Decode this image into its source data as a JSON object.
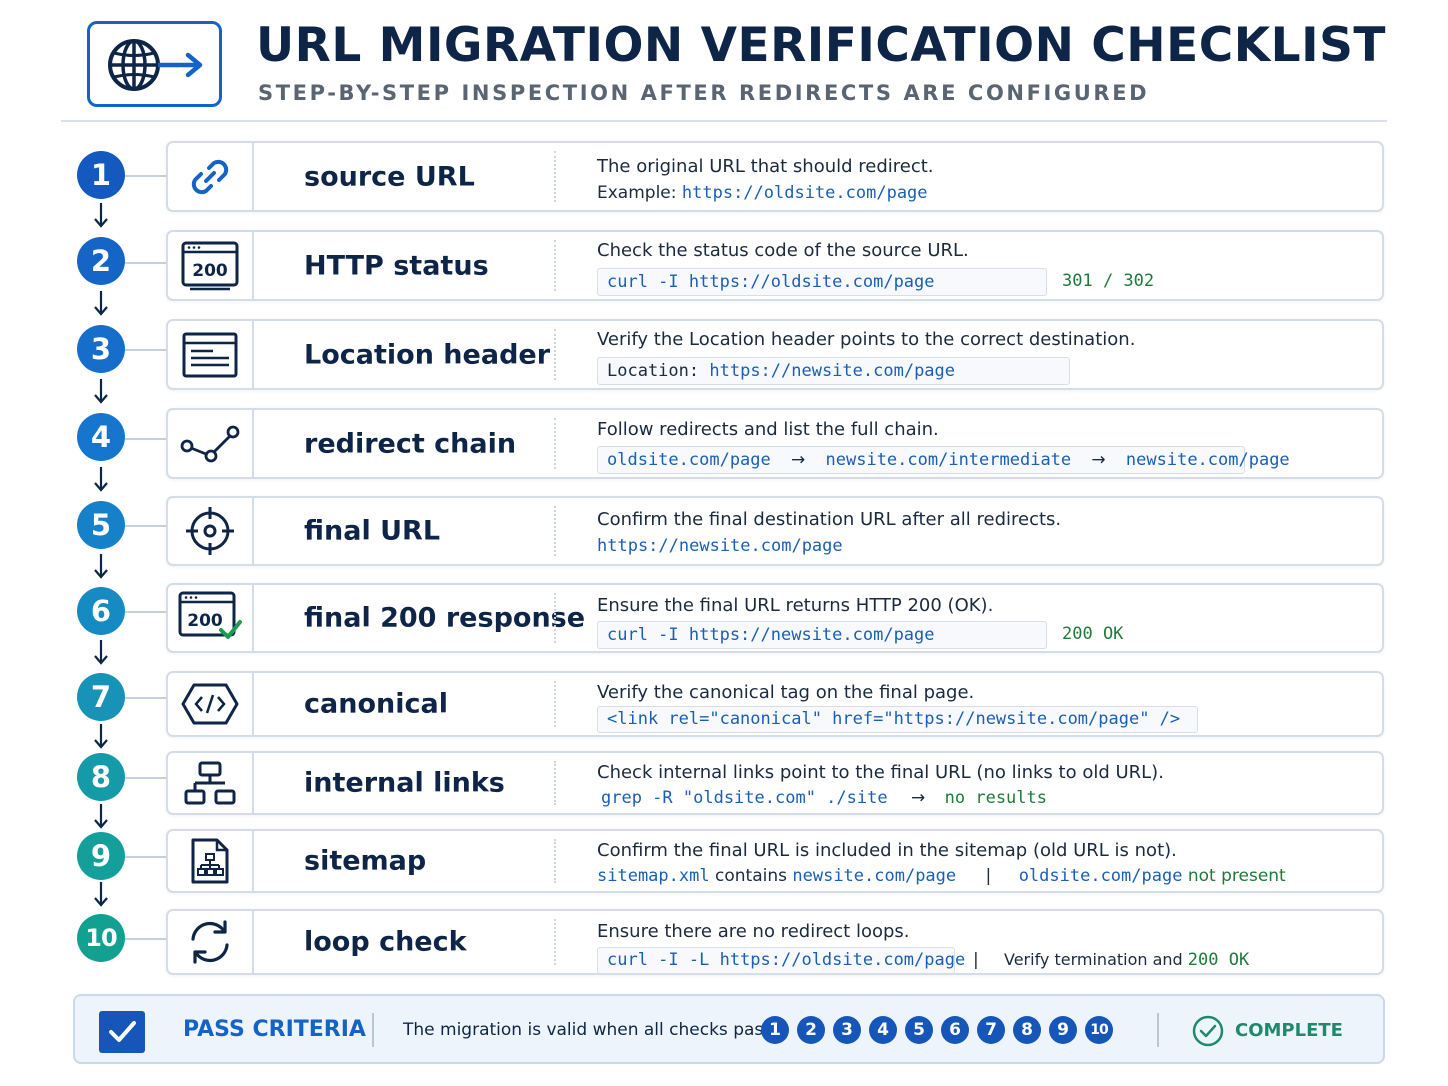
{
  "header": {
    "title": "URL MIGRATION VERIFICATION CHECKLIST",
    "subtitle": "STEP-BY-STEP INSPECTION AFTER REDIRECTS ARE CONFIGURED",
    "logo_icon": "globe-arrow-icon"
  },
  "steps": [
    {
      "num": "1",
      "label": "source URL",
      "icon": "link-icon",
      "color": "#1459be",
      "desc": "The original URL that should redirect.",
      "example_prefix": "Example:",
      "example_url": "https://oldsite.com/page"
    },
    {
      "num": "2",
      "label": "HTTP status",
      "icon": "browser-200-icon",
      "icon_text": "200",
      "color": "#1565c6",
      "desc": "Check the status code of the source URL.",
      "command": "curl -I https://oldsite.com/page",
      "result": "301 / 302"
    },
    {
      "num": "3",
      "label": "Location header",
      "icon": "document-lines-icon",
      "color": "#166dca",
      "desc": "Verify the Location header points to the correct destination.",
      "header_key": "Location:",
      "header_value": "https://newsite.com/page"
    },
    {
      "num": "4",
      "label": "redirect chain",
      "icon": "chain-nodes-icon",
      "color": "#1675cc",
      "desc": "Follow redirects and list the full chain.",
      "chain": [
        "oldsite.com/page",
        "newsite.com/intermediate",
        "newsite.com/page"
      ],
      "chain_arrow": "→"
    },
    {
      "num": "5",
      "label": "final URL",
      "icon": "crosshair-icon",
      "color": "#1680c9",
      "desc": "Confirm the final destination URL after all redirects.",
      "url": "https://newsite.com/page"
    },
    {
      "num": "6",
      "label": "final 200 response",
      "icon": "browser-200-check-icon",
      "icon_text": "200",
      "color": "#168ac2",
      "desc": "Ensure the final URL returns HTTP 200 (OK).",
      "command": "curl -I https://newsite.com/page",
      "result": "200 OK"
    },
    {
      "num": "7",
      "label": "canonical",
      "icon": "code-tag-icon",
      "color": "#1693b7",
      "desc": "Verify the canonical tag on the final page.",
      "code": "<link rel=\"canonical\" href=\"https://newsite.com/page\" />"
    },
    {
      "num": "8",
      "label": "internal links",
      "icon": "sitemap-tree-icon",
      "color": "#159aa8",
      "desc": "Check internal links point to the final URL (no links to old URL).",
      "command": "grep -R \"oldsite.com\" ./site",
      "arrow": "→",
      "result": "no results"
    },
    {
      "num": "9",
      "label": "sitemap",
      "icon": "sitemap-file-icon",
      "color": "#149f9b",
      "desc": "Confirm the final URL is included in the sitemap (old URL is not).",
      "file": "sitemap.xml",
      "contains": "contains",
      "new_url": "newsite.com/page",
      "divider": "|",
      "old_url": "oldsite.com/page",
      "not_present": "not present"
    },
    {
      "num": "10",
      "label": "loop check",
      "icon": "refresh-loop-icon",
      "color": "#12a190",
      "desc": "Ensure there are no redirect loops.",
      "command": "curl -I -L https://oldsite.com/page",
      "divider": "|",
      "verify_text": "Verify termination and",
      "verify_result": "200 OK"
    }
  ],
  "footer": {
    "label": "PASS CRITERIA",
    "text": "The migration is valid when all checks pass:",
    "badges": [
      "1",
      "2",
      "3",
      "4",
      "5",
      "6",
      "7",
      "8",
      "9",
      "10"
    ],
    "status": "COMPLETE",
    "check_icon": "checkbox-checked-icon",
    "status_icon": "check-circle-icon"
  }
}
